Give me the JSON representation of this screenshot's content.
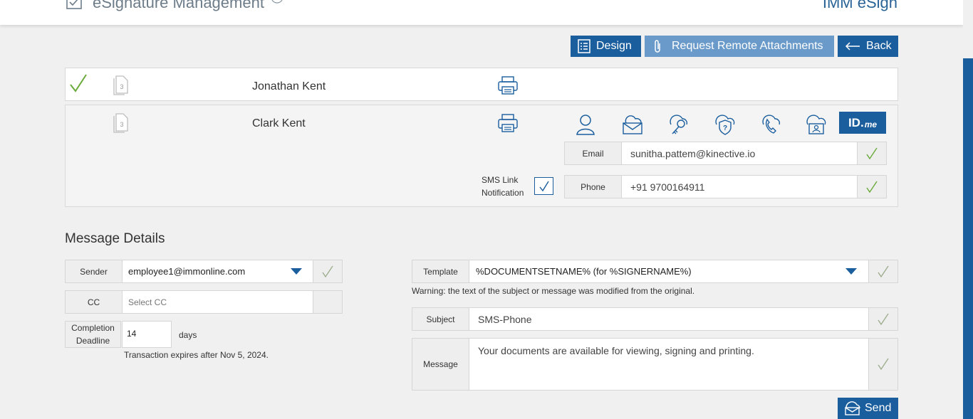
{
  "header": {
    "title": "eSignature Management",
    "brand": "IMM eSign"
  },
  "toolbar": {
    "design_label": "Design",
    "request_label": "Request Remote Attachments",
    "back_label": "Back"
  },
  "signers": [
    {
      "name": "Jonathan Kent",
      "doc_count": "3",
      "completed": true
    },
    {
      "name": "Clark Kent",
      "doc_count": "3",
      "completed": false
    }
  ],
  "auth_methods": [
    "user-icon",
    "email-icon",
    "key-icon",
    "shield-question-icon",
    "phone-icon",
    "id-card-icon"
  ],
  "idme": {
    "main": "ID.",
    "suffix": "me"
  },
  "contact": {
    "email_label": "Email",
    "email_value": "sunitha.pattem@kinective.io",
    "phone_label": "Phone",
    "phone_value": "+91 9700164911",
    "sms_label_line1": "SMS Link",
    "sms_label_line2": "Notification"
  },
  "message_details": {
    "title": "Message Details",
    "sender_label": "Sender",
    "sender_value": "employee1@immonline.com",
    "cc_label": "CC",
    "cc_placeholder": "Select CC",
    "deadline_label_line1": "Completion",
    "deadline_label_line2": "Deadline",
    "deadline_value": "14",
    "days_label": "days",
    "expires_text": "Transaction expires after Nov 5, 2024.",
    "template_label": "Template",
    "template_value": "%DOCUMENTSETNAME% (for %SIGNERNAME%)",
    "warning_text": "Warning: the text of the subject or message was modified from the original.",
    "subject_label": "Subject",
    "subject_value": "SMS-Phone",
    "message_label": "Message",
    "message_value": "Your documents are available for viewing, signing and printing.",
    "send_label": "Send"
  },
  "colors": {
    "primary": "#1b5e9e",
    "primary_light": "#6a9ac9",
    "check_green": "#6aaa3a",
    "background": "#f0f0f0"
  }
}
